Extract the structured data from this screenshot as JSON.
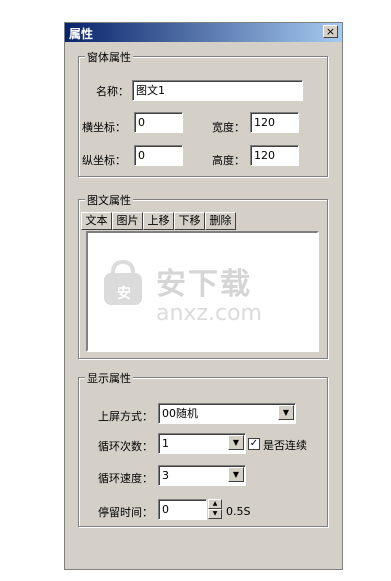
{
  "window": {
    "title": "属性",
    "close_glyph": "×"
  },
  "form_props": {
    "group_title": "窗体属性",
    "name_label": "名称：",
    "name_value": "图文1",
    "x_label": "横坐标：",
    "x_value": "0",
    "width_label": "宽度：",
    "width_value": "120",
    "y_label": "纵坐标：",
    "y_value": "0",
    "height_label": "高度：",
    "height_value": "120"
  },
  "image_props": {
    "group_title": "图文属性",
    "buttons": [
      "文本",
      "图片",
      "上移",
      "下移",
      "删除"
    ]
  },
  "display_props": {
    "group_title": "显示属性",
    "mode_label": "上屏方式：",
    "mode_value": "00随机",
    "loop_label": "循环次数：",
    "loop_value": "1",
    "continuous_label": "是否连续",
    "continuous_checked": true,
    "speed_label": "循环速度：",
    "speed_value": "3",
    "stay_label": "停留时间：",
    "stay_value": "0",
    "stay_unit": "0.5S"
  },
  "watermark": {
    "cn": "安下载",
    "en": "anxz.com",
    "badge": "安"
  }
}
